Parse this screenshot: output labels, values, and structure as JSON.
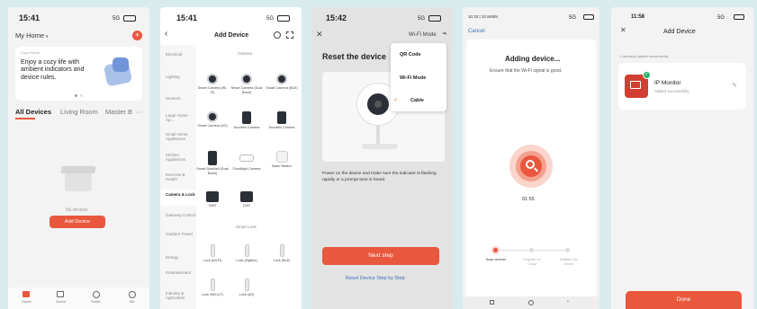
{
  "colors": {
    "accent": "#e9573d",
    "background": "#d8ecee"
  },
  "screen1": {
    "time": "15:41",
    "status": "5G",
    "home_label": "My Home",
    "banner_small": "Cozy Home",
    "banner_title": "Enjoy a cozy life with ambient indicators and device rules.",
    "tabs": [
      "All Devices",
      "Living Room",
      "Master B"
    ],
    "empty_text": "No devices",
    "add_device": "Add Device",
    "nav": [
      "Home",
      "Scene",
      "Smart",
      "Me"
    ]
  },
  "screen2": {
    "time": "15:41",
    "status": "5G",
    "title": "Add Device",
    "categories": [
      "Electrical",
      "Lighting",
      "Sensors",
      "Large Home Ap...",
      "Small Home Appliances",
      "Kitchen Appliances",
      "Exercise & Health",
      "Camera & Lock",
      "Gateway Control",
      "Outdoor Travel",
      "Energy",
      "Entertainment",
      "Industry & Agriculture"
    ],
    "section_camera": "Camera",
    "section_lock": "Smart Lock",
    "devices": [
      "Smart Camera (Wi-Fi)",
      "Smart Camera (Dual Band)",
      "Smart Camera (BLE)",
      "Smart Camera (4G)",
      "Doorbell Camera",
      "Doorbell Camera",
      "Smart Doorbell (Dual Band)",
      "Floodlight Camera",
      "Base Station",
      "NVR",
      "DVR",
      "Lock (Wi-Fi)",
      "Lock (Zigbee)",
      "Lock (BLE)",
      "Lock (NB-IoT)",
      "Lock (4G)"
    ]
  },
  "screen3": {
    "time": "15:42",
    "status": "5G",
    "mode_label": "Wi-Fi Mode",
    "menu": [
      "QR Code",
      "Wi-Fi Mode",
      "Cable"
    ],
    "title": "Reset the device",
    "instruction": "Power on the device and make sure the indicator is flashing rapidly or a prompt tone is heard.",
    "next_step": "Next step",
    "reset_link": "Reset Device Step by Step"
  },
  "screen4": {
    "status_left": "10:33 | 10.9KB/s",
    "status_right": "5G",
    "cancel": "Cancel",
    "title": "Adding device...",
    "subtitle": "Ensure that the Wi-Fi signal is good.",
    "timer": "01:55",
    "steps": [
      "Scan devices",
      "Register on Cloud",
      "Initialize the device"
    ]
  },
  "screen5": {
    "time": "11:58",
    "status": "5G",
    "title": "Add Device",
    "success_note": "1 device(s) added successfully",
    "device_name": "IP Monitor",
    "device_status": "Added successfully",
    "done": "Done"
  }
}
